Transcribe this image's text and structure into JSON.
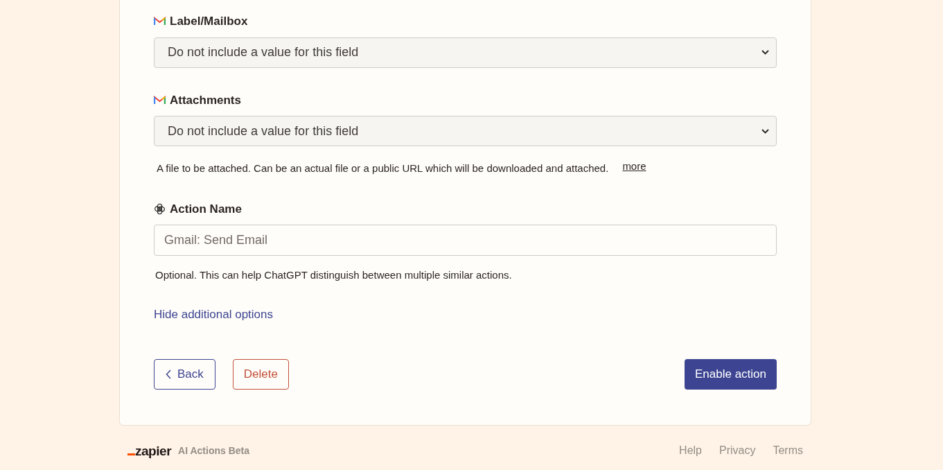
{
  "fields": [
    {
      "label": "Label/Mailbox",
      "kind": "select",
      "value": "Do not include a value for this field"
    },
    {
      "label": "Attachments",
      "kind": "select",
      "value": "Do not include a value for this field",
      "help": "A file to be attached. Can be an actual file or a public URL which will be downloaded and attached.",
      "more": "more"
    },
    {
      "label": "Action Name",
      "kind": "text",
      "placeholder": "Gmail: Send Email",
      "help": "Optional. This can help ChatGPT distinguish between multiple similar actions."
    }
  ],
  "toggle_link": "Hide additional options",
  "buttons": {
    "back": "Back",
    "delete": "Delete",
    "enable": "Enable action"
  },
  "footer": {
    "logo": "zapier",
    "product": "AI Actions Beta",
    "links": [
      "Help",
      "Privacy",
      "Terms"
    ]
  }
}
